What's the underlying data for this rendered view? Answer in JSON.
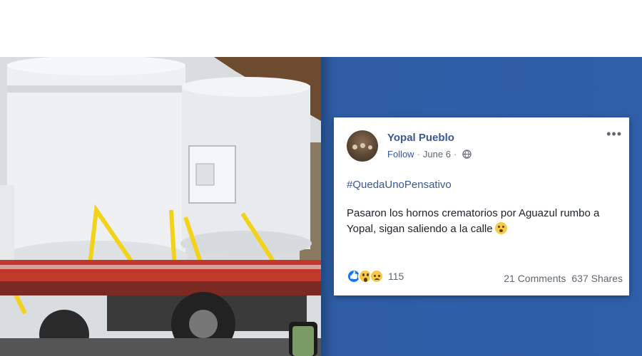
{
  "post": {
    "page_name": "Yopal Pueblo",
    "follow_label": "Follow",
    "date": "June 6",
    "separator": "·",
    "hashtag": "#QuedaUnoPensativo",
    "text": "Pasaron los hornos crematorios por Aguazul rumbo a Yopal, sigan saliendo a la calle",
    "text_emoji": "sad-face-emoji",
    "reaction_icons": [
      "like-icon",
      "wow-icon",
      "sad-icon"
    ],
    "reaction_count": "115",
    "comments": "21 Comments",
    "shares": "637 Shares",
    "more_icon": "more-options-icon",
    "privacy_icon": "globe-icon"
  },
  "colors": {
    "link_blue": "#385898",
    "backdrop_blue": "#2e5da6",
    "strap_yellow": "#f2d21b",
    "truck_red": "#c0392b"
  }
}
